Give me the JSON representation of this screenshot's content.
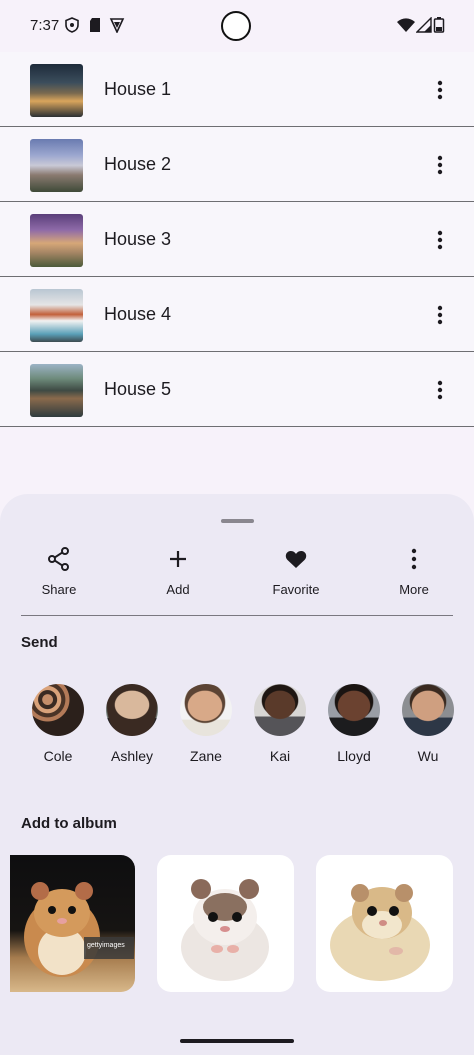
{
  "status": {
    "time": "7:37"
  },
  "houses": [
    {
      "label": "House 1"
    },
    {
      "label": "House 2"
    },
    {
      "label": "House 3"
    },
    {
      "label": "House 4"
    },
    {
      "label": "House 5"
    }
  ],
  "sheet": {
    "actions": [
      {
        "label": "Share",
        "icon": "share-icon"
      },
      {
        "label": "Add",
        "icon": "add-icon"
      },
      {
        "label": "Favorite",
        "icon": "heart-icon"
      },
      {
        "label": "More",
        "icon": "more-vertical-icon"
      }
    ],
    "send_title": "Send",
    "contacts": [
      {
        "name": "Cole"
      },
      {
        "name": "Ashley"
      },
      {
        "name": "Zane"
      },
      {
        "name": "Kai"
      },
      {
        "name": "Lloyd"
      },
      {
        "name": "Wu"
      }
    ],
    "album_title": "Add to album",
    "albums": [
      {
        "watermark": "gettyimages"
      },
      {},
      {}
    ]
  },
  "colors": {
    "background": "#f7f2fa",
    "sheet": "#ece9f4",
    "text": "#1d1b20"
  }
}
